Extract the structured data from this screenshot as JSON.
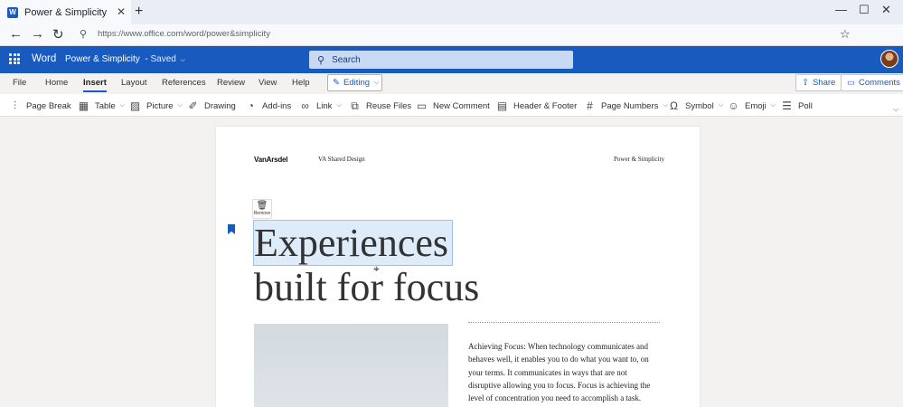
{
  "browser": {
    "tab_title": "Power & Simplicity",
    "favicon_label": "W",
    "url": "https://www.office.com/word/power&simplicity"
  },
  "app": {
    "name": "Word",
    "doc_title": "Power & Simplicity",
    "doc_status": "Saved",
    "search_placeholder": "Search"
  },
  "ribbon": {
    "tabs": [
      "File",
      "Home",
      "Insert",
      "Layout",
      "References",
      "Review",
      "View",
      "Help"
    ],
    "active_tab": "Insert",
    "editing_label": "Editing",
    "share_label": "Share",
    "comments_label": "Comments"
  },
  "commands": [
    {
      "label": "Page Break",
      "icon": "page-break-icon"
    },
    {
      "label": "Table",
      "icon": "table-icon"
    },
    {
      "label": "Picture",
      "icon": "picture-icon"
    },
    {
      "label": "Drawing",
      "icon": "drawing-icon"
    },
    {
      "label": "Add-ins",
      "icon": "addins-icon"
    },
    {
      "label": "Link",
      "icon": "link-icon"
    },
    {
      "label": "Reuse Files",
      "icon": "reuse-files-icon"
    },
    {
      "label": "New Comment",
      "icon": "comment-icon"
    },
    {
      "label": "Header & Footer",
      "icon": "header-footer-icon"
    },
    {
      "label": "Page Numbers",
      "icon": "page-numbers-icon"
    },
    {
      "label": "Symbol",
      "icon": "omega-icon"
    },
    {
      "label": "Emoji",
      "icon": "emoji-icon"
    },
    {
      "label": "Poll",
      "icon": "poll-icon"
    }
  ],
  "document": {
    "header_logo": "VanArsdel",
    "header_center": "VA Shared Design",
    "header_right": "Power & Simplicity",
    "remove_label": "Remove",
    "headline_line1": "Experiences",
    "headline_line2": "built for focus",
    "body": "Achieving Focus: When technology communicates and behaves well, it enables you to do what you want to, on your terms. It communicates in ways that are not disruptive allowing you to focus. Focus is achieving the level of concentration you need to accomplish a task."
  },
  "colors": {
    "word_blue": "#185abd",
    "selection": "#deecf9"
  }
}
